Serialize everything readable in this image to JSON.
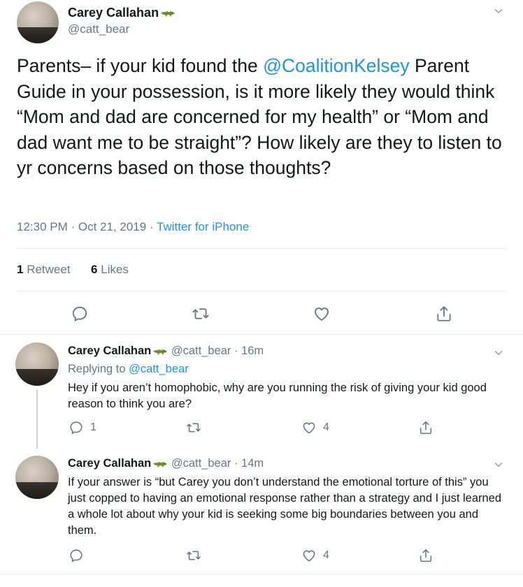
{
  "main_tweet": {
    "author_name": "Carey Callahan",
    "author_handle": "@catt_bear",
    "text_before_mention": "Parents– if your kid found the ",
    "mention": "@CoalitionKelsey",
    "text_after_mention": " Parent Guide in your possession, is it more likely they would think “Mom and dad are concerned for my health” or “Mom and dad want me to be straight”? How likely are they to listen to yr concerns based on those thoughts?",
    "time": "12:30 PM",
    "dot1": " · ",
    "date": "Oct 21, 2019",
    "dot2": " · ",
    "source": "Twitter for iPhone",
    "retweet_count": "1",
    "retweet_label": "Retweet",
    "like_count": "6",
    "like_label": "Likes"
  },
  "replies": [
    {
      "author_name": "Carey Callahan",
      "author_handle": "@catt_bear",
      "age": " · 16m",
      "replying_label": "Replying to ",
      "replying_to": "@catt_bear",
      "text": "Hey if you aren’t homophobic, why are you running the risk of giving your kid good reason to think you are?",
      "reply_count": "1",
      "retweet_count": "",
      "like_count": "4"
    },
    {
      "author_name": "Carey Callahan",
      "author_handle": "@catt_bear",
      "age": " · 14m",
      "text": "If your answer is “but Carey you don’t understand the emotional torture of this” you just copped to having an emotional response rather than a strategy and I just learned a whole lot about why your kid is seeking some big boundaries between you and them.",
      "reply_count": "",
      "retweet_count": "",
      "like_count": "4"
    }
  ],
  "icons": {
    "reply": "reply-icon",
    "retweet": "retweet-icon",
    "like": "heart-icon",
    "share": "share-icon",
    "more": "chevron-down-icon",
    "badge": "crocodile-emoji-icon"
  },
  "colors": {
    "text": "#14171a",
    "secondary": "#657786",
    "link": "#1b95e0",
    "divider": "#e1e8ed",
    "thread_line": "#ccd6dd"
  }
}
